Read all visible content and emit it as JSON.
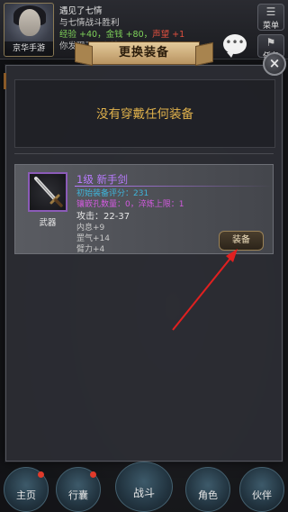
{
  "hud": {
    "avatar_name": "京华手游",
    "menu_label": "菜单",
    "task_label": "任务",
    "chat_bubble": "•••",
    "messages": {
      "line1": "遇见了七情",
      "line2": "与七情战斗胜利",
      "line3_gain": "经验 +40，金钱 +80，",
      "line3_red": "声望 +1",
      "line4": "你发现了一七情"
    }
  },
  "modal": {
    "title": "更换装备",
    "close_icon": "×",
    "empty_text": "没有穿戴任何装备"
  },
  "item": {
    "type": "武器",
    "name": "1级 新手剑",
    "score": "初始装备评分：231",
    "socket": "镶嵌孔数量：0，淬炼上限：1",
    "attack": "攻击：22-37",
    "attr1": "内息+9",
    "attr2": "罡气+14",
    "attr3": "臂力+4",
    "equip_label": "装备",
    "icon": "sword-icon",
    "rarity_color": "#b97bff"
  },
  "nav": {
    "home": "主页",
    "bag": "行囊",
    "fight": "战斗",
    "role": "角色",
    "mate": "伙伴"
  }
}
